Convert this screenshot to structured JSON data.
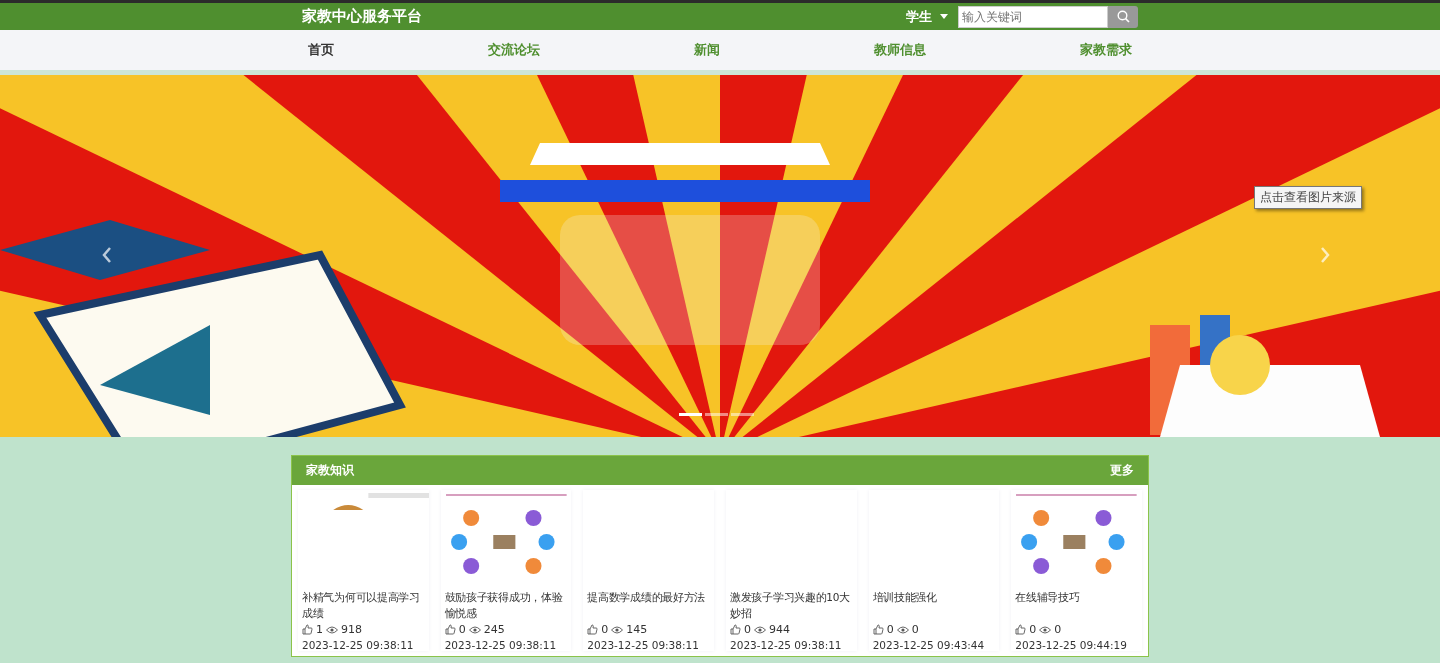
{
  "header": {
    "title": "家教中心服务平台",
    "role": "学生",
    "search": {
      "placeholder": "输入关键词"
    }
  },
  "nav": [
    {
      "label": "首页",
      "selected": true
    },
    {
      "label": "交流论坛",
      "selected": false
    },
    {
      "label": "新闻",
      "selected": false
    },
    {
      "label": "教师信息",
      "selected": false
    },
    {
      "label": "家教需求",
      "selected": false
    }
  ],
  "banner": {
    "kind": "picture",
    "tooltip": "点击查看图片来源",
    "slides": [
      {
        "selected": true
      },
      {
        "selected": false
      },
      {
        "selected": false
      }
    ]
  },
  "section": {
    "title": "家教知识",
    "more": "更多",
    "items": [
      {
        "kind": "picture",
        "title": "补精气为何可以提高学习成绩",
        "likes": "1",
        "views": "918",
        "date": "2023-12-25 09:38:11"
      },
      {
        "kind": "picture",
        "title": "鼓励孩子获得成功，体验愉悦感",
        "likes": "0",
        "views": "245",
        "date": "2023-12-25 09:38:11"
      },
      {
        "kind": "blank",
        "title": "提高数学成绩的最好方法",
        "likes": "0",
        "views": "145",
        "date": "2023-12-25 09:38:11"
      },
      {
        "kind": "blank",
        "title": "激发孩子学习兴趣的10大妙招",
        "likes": "0",
        "views": "944",
        "date": "2023-12-25 09:38:11"
      },
      {
        "kind": "blank",
        "title": "培训技能强化",
        "likes": "0",
        "views": "0",
        "date": "2023-12-25 09:43:44"
      },
      {
        "kind": "picture",
        "title": "在线辅导技巧",
        "likes": "0",
        "views": "0",
        "date": "2023-12-25 09:44:19"
      }
    ]
  }
}
